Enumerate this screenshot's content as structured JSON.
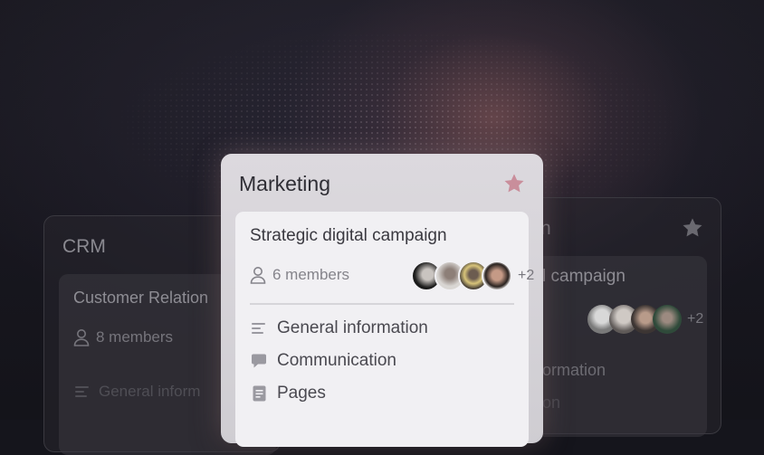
{
  "left_card": {
    "title": "CRM",
    "subtitle": "Customer Relation",
    "members": "8 members",
    "menu_item": "General inform"
  },
  "right_card": {
    "title_fragment": "n",
    "subtitle_fragment": "l campaign",
    "more_count": "+2",
    "menu_item_1": "ormation",
    "menu_item_2": "on"
  },
  "main_card": {
    "title": "Marketing",
    "project": {
      "title": "Strategic digital campaign",
      "members": "6 members",
      "more_count": "+2"
    },
    "menu": [
      {
        "label": "General information",
        "icon": "lines-icon"
      },
      {
        "label": "Communication",
        "icon": "chat-bubble-icon"
      },
      {
        "label": "Pages",
        "icon": "document-icon"
      }
    ]
  },
  "colors": {
    "star_main": "#c98e9b",
    "star_dim": "#6a6970",
    "background": "#15151c"
  }
}
